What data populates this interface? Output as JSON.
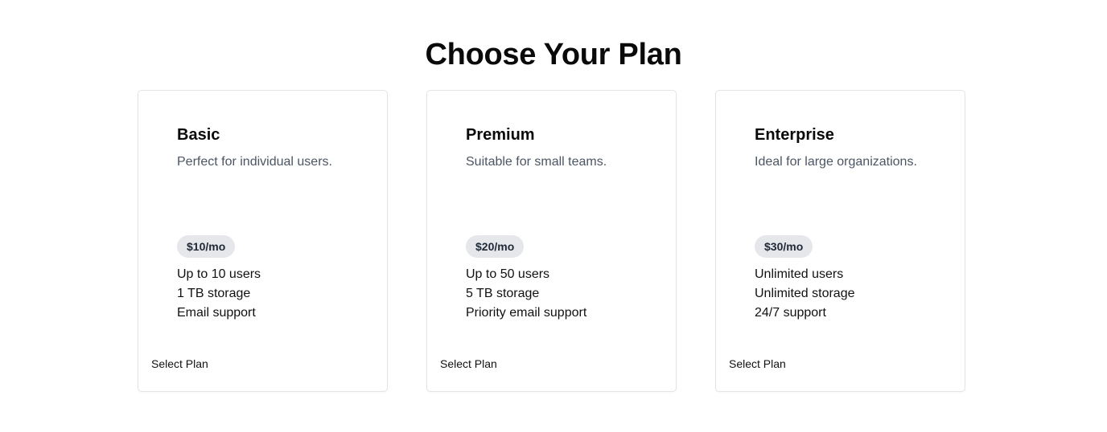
{
  "page": {
    "title": "Choose Your Plan"
  },
  "plans": [
    {
      "name": "Basic",
      "description": "Perfect for individual users.",
      "price": "$10/mo",
      "features": [
        "Up to 10 users",
        "1 TB storage",
        "Email support"
      ],
      "button_label": "Select Plan"
    },
    {
      "name": "Premium",
      "description": "Suitable for small teams.",
      "price": "$20/mo",
      "features": [
        "Up to 50 users",
        "5 TB storage",
        "Priority email support"
      ],
      "button_label": "Select Plan"
    },
    {
      "name": "Enterprise",
      "description": "Ideal for large organizations.",
      "price": "$30/mo",
      "features": [
        "Unlimited users",
        "Unlimited storage",
        "24/7 support"
      ],
      "button_label": "Select Plan"
    }
  ],
  "colors": {
    "background": "#ffffff",
    "card_border": "#e4e4e7",
    "badge_background": "#e5e7eb",
    "description_text": "#4b5563"
  }
}
